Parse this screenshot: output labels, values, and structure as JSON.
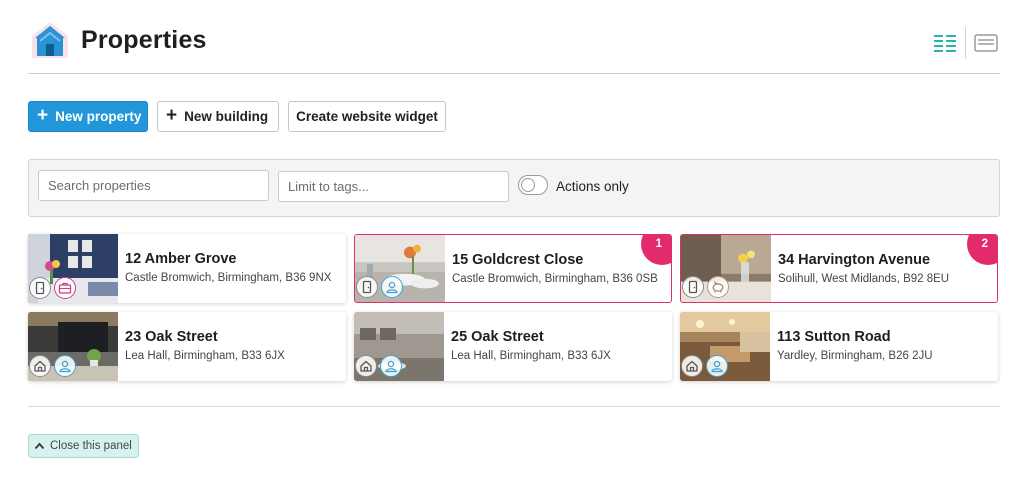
{
  "header": {
    "title": "Properties",
    "logo_icon": "house-logo-icon",
    "view_list_icon": "list-view-icon",
    "view_card_icon": "card-view-icon"
  },
  "actions": {
    "new_property": "New property",
    "new_building": "New building",
    "create_widget": "Create website widget"
  },
  "filters": {
    "search_placeholder": "Search properties",
    "tags_placeholder": "Limit to tags...",
    "actions_only_label": "Actions only",
    "actions_only_checked": false
  },
  "cards": [
    {
      "title": "12 Amber Grove",
      "address": "Castle Bromwich, Birmingham, B36 9NX",
      "badge": null,
      "chips": [
        "door-icon",
        "briefcase-icon"
      ]
    },
    {
      "title": "15 Goldcrest Close",
      "address": "Castle Bromwich, Birmingham, B36 0SB",
      "badge": "1",
      "chips": [
        "door-icon",
        "person-icon"
      ]
    },
    {
      "title": "34 Harvington Avenue",
      "address": "Solihull, West Midlands, B92 8EU",
      "badge": "2",
      "chips": [
        "door-icon",
        "piggy-bank-icon"
      ]
    },
    {
      "title": "23 Oak Street",
      "address": "Lea Hall, Birmingham, B33 6JX",
      "badge": null,
      "chips": [
        "house-icon",
        "person-icon"
      ]
    },
    {
      "title": "25 Oak Street",
      "address": "Lea Hall, Birmingham, B33 6JX",
      "badge": null,
      "chips": [
        "house-icon",
        "person-icon"
      ]
    },
    {
      "title": "113 Sutton Road",
      "address": "Yardley, Birmingham, B26 2JU",
      "badge": null,
      "chips": [
        "house-icon",
        "person-icon"
      ]
    }
  ],
  "footer": {
    "close_panel": "Close this panel"
  },
  "colors": {
    "primary": "#2196d8",
    "alert": "#e32a6d",
    "teal": "#2bb3a7"
  }
}
